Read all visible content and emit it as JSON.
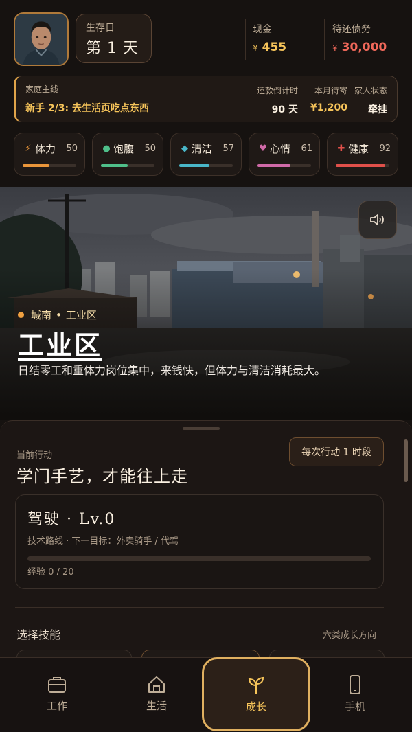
{
  "header": {
    "day_label": "生存日",
    "day_value": "第 1 天",
    "cash_label": "现金",
    "cash_currency": "¥",
    "cash_value": "455",
    "debt_label": "待还债务",
    "debt_currency": "¥",
    "debt_value": "30,000",
    "avatar_icon": "player-portrait"
  },
  "quest": {
    "label": "家庭主线",
    "text": "新手 2/3: 去生活页吃点东西",
    "countdown_label": "还款倒计时",
    "countdown_value": "90 天",
    "monthly_label": "本月待寄",
    "monthly_value": "¥1,200",
    "family_label": "家人状态",
    "family_value": "牵挂"
  },
  "stats": [
    {
      "icon": "⚡",
      "name": "体力",
      "value": 50,
      "fill": 0.5,
      "color": "#e9953a"
    },
    {
      "icon": "●",
      "name": "饱腹",
      "value": 50,
      "fill": 0.5,
      "color": "#4fbf8a"
    },
    {
      "icon": "◆",
      "name": "清洁",
      "value": 57,
      "fill": 0.57,
      "color": "#49b6c8"
    },
    {
      "icon": "♥",
      "name": "心情",
      "value": 61,
      "fill": 0.61,
      "color": "#d06aa8"
    },
    {
      "icon": "✚",
      "name": "健康",
      "value": 92,
      "fill": 0.92,
      "color": "#e0504a"
    }
  ],
  "location": {
    "district": "城南",
    "area": "工业区",
    "separator": "•",
    "title": "工业区",
    "description": "日结零工和重体力岗位集中，来钱快，但体力与清洁消耗最大。"
  },
  "action": {
    "current_label": "当前行动",
    "title": "学门手艺，才能往上走",
    "frequency_button": "每次行动 1 时段",
    "skill_name": "驾驶  ·  Lv.0",
    "skill_route": "技术路线 · 下一目标：外卖骑手 / 代驾",
    "exp_label": "经验 0 / 20",
    "exp_fraction": 0,
    "choose_label": "选择技能",
    "choose_hint": "六类成长方向"
  },
  "nav": [
    {
      "label": "工作",
      "icon": "briefcase-icon"
    },
    {
      "label": "生活",
      "icon": "home-icon"
    },
    {
      "label": "成长",
      "icon": "sprout-icon",
      "active": true
    },
    {
      "label": "手机",
      "icon": "phone-icon"
    }
  ]
}
